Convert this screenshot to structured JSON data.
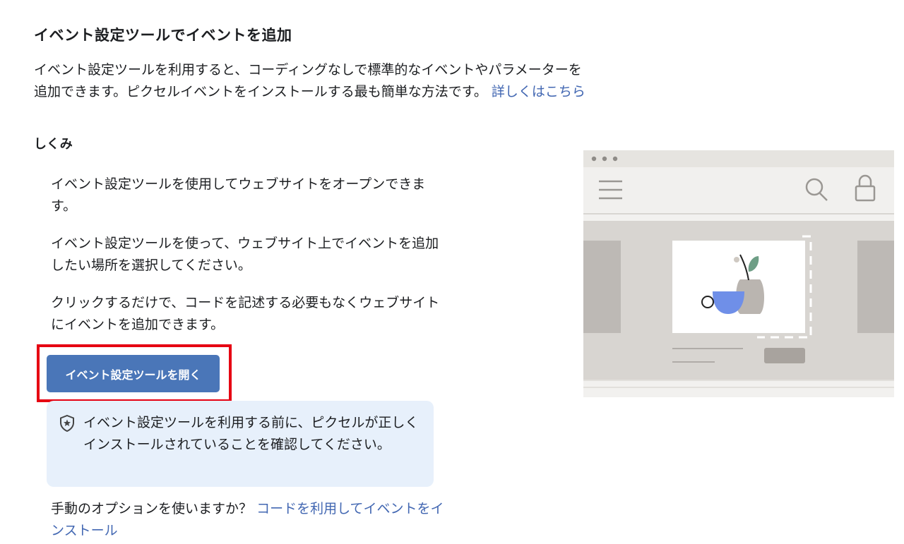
{
  "header": {
    "title": "イベント設定ツールでイベントを追加",
    "intro_line1": "イベント設定ツールを利用すると、コーディングなしで標準的なイベントやパラメーターを",
    "intro_line2": "追加できます。ピクセルイベントをインストールする最も簡単な方法です。",
    "learn_more": "詳しくはこちら"
  },
  "how_it_works": {
    "title": "しくみ",
    "steps": [
      "イベント設定ツールを使用してウェブサイトをオープンできます。",
      "イベント設定ツールを使って、ウェブサイト上でイベントを追加したい場所を選択してください。",
      "クリックするだけで、コードを記述する必要もなくウェブサイトにイベントを追加できます。"
    ]
  },
  "open_button_label": "イベント設定ツールを開く",
  "notice": {
    "icon": "shield-star-icon",
    "text": "イベント設定ツールを利用する前に、ピクセルが正しくインストールされていることを確認してください。"
  },
  "manual": {
    "question": "手動のオプションを使いますか？",
    "link": "コードを利用してイベントをインストール"
  },
  "illustration": {
    "icons": [
      "hamburger-menu-icon",
      "search-icon",
      "lock-icon"
    ]
  },
  "colors": {
    "primary_button": "#4a76b8",
    "link": "#4267b2",
    "highlight_border": "#e60012",
    "notice_bg": "#e7f0fb"
  }
}
